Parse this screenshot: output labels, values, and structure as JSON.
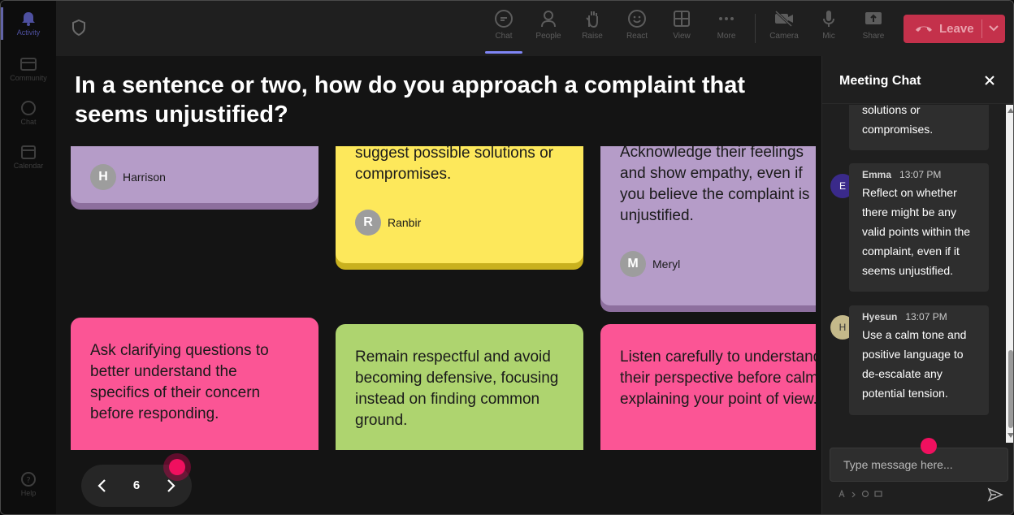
{
  "rail": {
    "items": [
      {
        "label": "Activity",
        "icon": "bell-icon"
      },
      {
        "label": "Community",
        "icon": "community-icon"
      },
      {
        "label": "Chat",
        "icon": "chat-icon"
      },
      {
        "label": "Calendar",
        "icon": "calendar-icon"
      },
      {
        "label": "Help",
        "icon": "help-icon"
      }
    ]
  },
  "toolbar": {
    "chat": "Chat",
    "people": "People",
    "raise": "Raise",
    "react": "React",
    "view": "View",
    "more": "More",
    "camera": "Camera",
    "mic": "Mic",
    "share": "Share",
    "leave": "Leave"
  },
  "question": "In a sentence or two, how do you approach a complaint that seems unjustified?",
  "cards": [
    {
      "text": "",
      "author": "Harrison",
      "initial": "H"
    },
    {
      "text": "suggest possible solutions or compromises.",
      "author": "Ranbir",
      "initial": "R"
    },
    {
      "text": "Acknowledge their feelings and show empathy, even if you believe the complaint is unjustified.",
      "author": "Meryl",
      "initial": "M"
    },
    {
      "text": "Ask clarifying questions to better understand the specifics of their concern before responding.",
      "author": "",
      "initial": ""
    },
    {
      "text": "Remain respectful and avoid becoming defensive, focusing instead on finding common ground.",
      "author": "",
      "initial": ""
    },
    {
      "text": "Listen carefully to understand their perspective before calmly explaining your point of view.",
      "author": "",
      "initial": ""
    }
  ],
  "pager": {
    "page": "6"
  },
  "chat": {
    "title": "Meeting Chat",
    "messages": [
      {
        "name": "",
        "time": "",
        "initial": "",
        "text": "solutions or compromises."
      },
      {
        "name": "Emma",
        "time": "13:07 PM",
        "initial": "E",
        "text": "Reflect on whether there might be any valid points within the complaint, even if it seems unjustified."
      },
      {
        "name": "Hyesun",
        "time": "13:07 PM",
        "initial": "H",
        "text": "Use a calm tone and positive language to de-escalate any potential tension."
      }
    ],
    "input_placeholder": "Type message here..."
  },
  "colors": {
    "accent": "#7f85f5",
    "leave": "#c4314b",
    "card_purple": "#b59cc8",
    "card_yellow": "#fde85b",
    "card_pink": "#fb5595",
    "card_green": "#aed46f"
  }
}
